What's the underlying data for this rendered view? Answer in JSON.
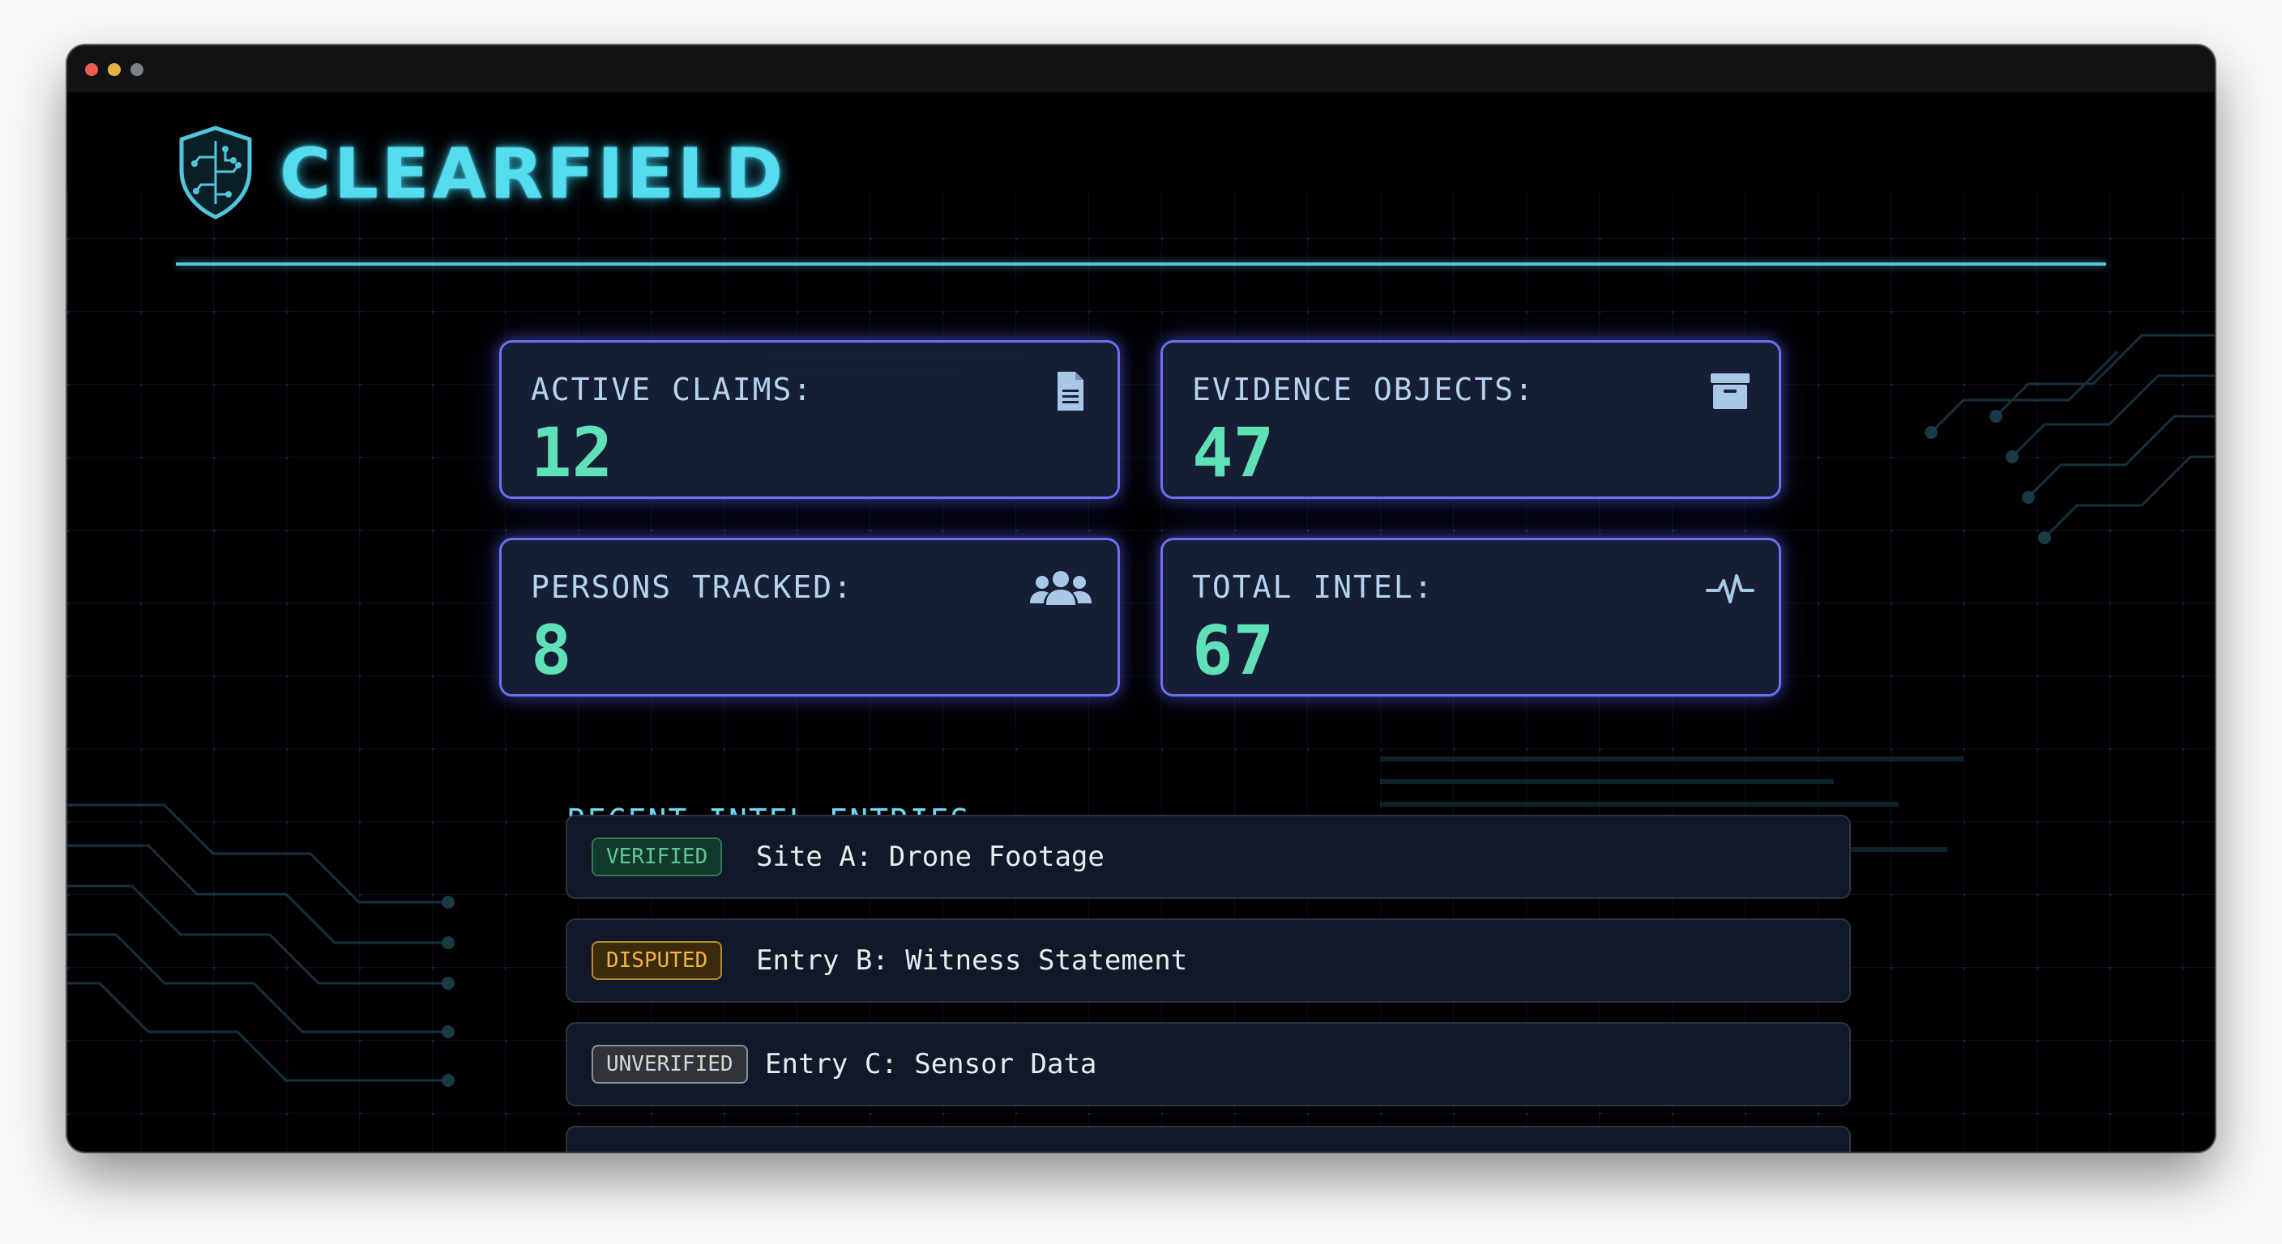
{
  "app": {
    "name": "CLEARFIELD",
    "accent": "#55ddef",
    "card_border": "#6b6ff0",
    "value_color": "#5fe0b7"
  },
  "stats": [
    {
      "label": "ACTIVE CLAIMS:",
      "value": "12",
      "icon": "document-icon"
    },
    {
      "label": "EVIDENCE OBJECTS:",
      "value": "47",
      "icon": "archive-box-icon"
    },
    {
      "label": "PERSONS TRACKED:",
      "value": "8",
      "icon": "users-icon"
    },
    {
      "label": "TOTAL INTEL:",
      "value": "67",
      "icon": "activity-pulse-icon"
    }
  ],
  "recent": {
    "title": "RECENT INTEL ENTRIES",
    "entries": [
      {
        "status": "VERIFIED",
        "status_color": "#5fc793",
        "text": "Site A: Drone Footage"
      },
      {
        "status": "DISPUTED",
        "status_color": "#f1b640",
        "text": "Entry B: Witness Statement"
      },
      {
        "status": "UNVERIFIED",
        "status_color": "#d6d8dc",
        "text": "Entry C: Sensor Data"
      }
    ]
  }
}
